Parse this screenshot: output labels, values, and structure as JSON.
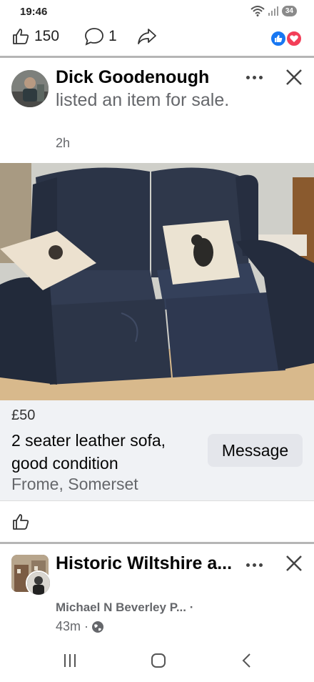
{
  "status_bar": {
    "time": "19:46",
    "battery": "34"
  },
  "reaction_bar": {
    "likes": "150",
    "comments": "1"
  },
  "post": {
    "author": "Dick Goodenough",
    "action": "listed an item for sale.",
    "time": "2h"
  },
  "listing": {
    "price": "£50",
    "title": "2 seater leather sofa, good condition",
    "location": "Frome, Somerset",
    "message_label": "Message"
  },
  "post2": {
    "title": "Historic Wiltshire a...",
    "author": "Michael N Beverley P... ·",
    "time": "43m ·"
  },
  "colors": {
    "facebook_blue": "#1877f2",
    "love_red": "#f33e58",
    "secondary_text": "#65676b"
  }
}
